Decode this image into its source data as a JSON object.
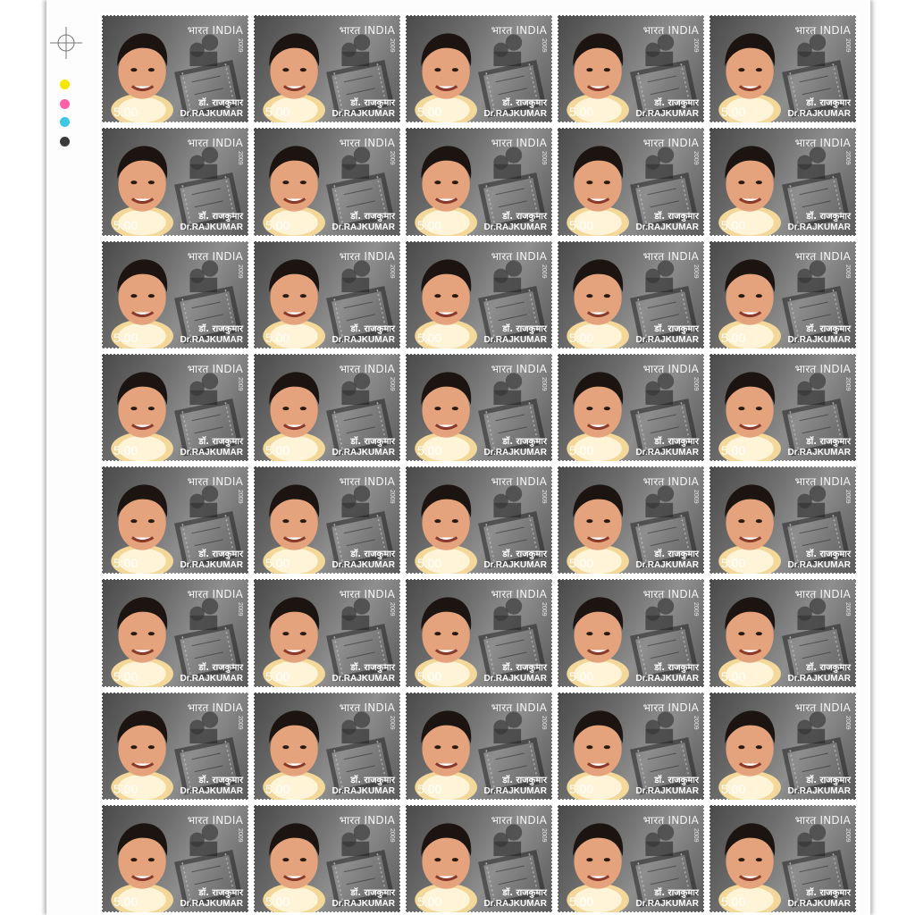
{
  "sheet": {
    "columns": 5,
    "rows": 8,
    "color_dots": [
      "#f7e600",
      "#ff5fa8",
      "#3cc7e3",
      "#3a3a3a"
    ]
  },
  "stamp": {
    "country": "भारत INDIA",
    "year": "2009",
    "name_hindi": "डॉ. राजकुमार",
    "name_english": "Dr.RAJKUMAR",
    "value": "5.00",
    "portrait": "portrait-photo",
    "background_art": "movie-camera-film-reel"
  }
}
